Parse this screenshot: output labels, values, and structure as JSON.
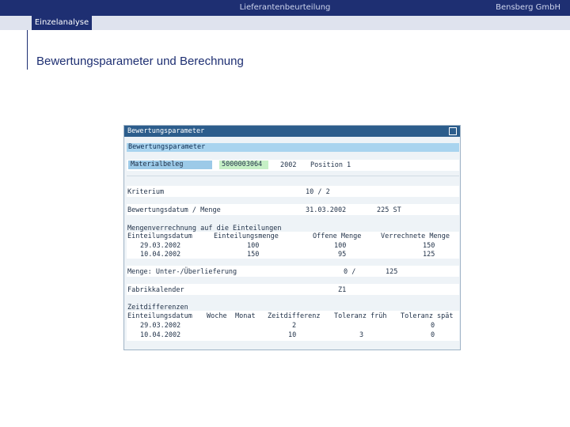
{
  "header": {
    "title": "Lieferantenbeurteilung",
    "company": "Bensberg GmbH"
  },
  "nav": {
    "tab_label": "Einzelanalyse"
  },
  "page": {
    "heading": "Bewertungsparameter und Berechnung"
  },
  "screen": {
    "window_title": "Bewertungsparameter",
    "section": "Bewertungsparameter",
    "beleg": {
      "label": "Materialbeleg",
      "number": "5000003064",
      "year": "2002",
      "position": "Position 1"
    },
    "kriterium": {
      "label": "Kriterium",
      "value": "10 / 2"
    },
    "bewertung": {
      "label": "Bewertungsdatum / Menge",
      "date": "31.03.2002",
      "qty": "225 ST"
    },
    "verrechnung": {
      "title": "Mengenverrechnung auf die Einteilungen",
      "columns": [
        "Einteilungsdatum",
        "Einteilungsmenge",
        "Offene Menge",
        "Verrechnete Menge"
      ],
      "rows": [
        [
          "29.03.2002",
          "100",
          "100",
          "150"
        ],
        [
          "10.04.2002",
          "150",
          "95",
          "125"
        ]
      ]
    },
    "unterueber": {
      "label": "Menge: Unter-/Überlieferung",
      "v1": "0 /",
      "v2": "125"
    },
    "fabrik": {
      "label": "Fabrikkalender",
      "value": "Z1"
    },
    "zeit": {
      "title": "Zeitdifferenzen",
      "columns": [
        "Einteilungsdatum",
        "Woche",
        "Monat",
        "Zeitdifferenz",
        "Toleranz früh",
        "Toleranz spät"
      ],
      "rows": [
        [
          "29.03.2002",
          "",
          "",
          "2",
          "",
          "0"
        ],
        [
          "10.04.2002",
          "",
          "",
          "10",
          "3",
          "0"
        ]
      ]
    }
  },
  "colors": {
    "brand": "#1e2f72",
    "section_bg": "#a9d4ef",
    "window_title_bg": "#2c5d8c",
    "highlight": "#c6f0c6"
  }
}
